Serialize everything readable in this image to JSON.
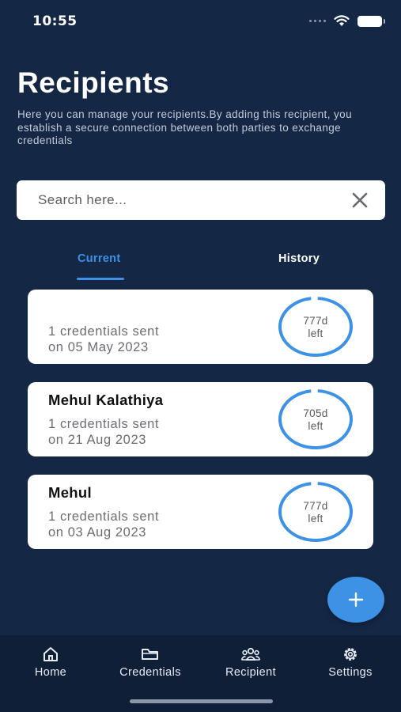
{
  "status_bar": {
    "time": "10:55",
    "icons": [
      "signal-dots-icon",
      "wifi-icon",
      "battery-icon"
    ]
  },
  "header": {
    "title": "Recipients",
    "description": "Here you can manage your recipients.By adding this recipient, you establish a secure connection between both parties to exchange credentials"
  },
  "search": {
    "placeholder": "Search here...",
    "value": "",
    "clear_icon": "close-icon"
  },
  "tabs": [
    {
      "label": "Current",
      "active": true
    },
    {
      "label": "History",
      "active": false
    }
  ],
  "recipients": [
    {
      "name": "",
      "sent": "1 credentials sent",
      "date": "on 05 May 2023",
      "days": "777d",
      "suffix": "left",
      "progress": 0.97
    },
    {
      "name": "Mehul Kalathiya",
      "sent": "1 credentials sent",
      "date": "on 21 Aug 2023",
      "days": "705d",
      "suffix": "left",
      "progress": 0.97
    },
    {
      "name": "Mehul",
      "sent": "1 credentials sent",
      "date": "on 03 Aug 2023",
      "days": "777d",
      "suffix": "left",
      "progress": 0.97
    }
  ],
  "fab": {
    "icon": "plus-icon"
  },
  "bottom_nav": [
    {
      "label": "Home",
      "icon": "home-icon"
    },
    {
      "label": "Credentials",
      "icon": "folder-icon"
    },
    {
      "label": "Recipient",
      "icon": "group-icon"
    },
    {
      "label": "Settings",
      "icon": "gear-icon"
    }
  ],
  "colors": {
    "background": "#142845",
    "accent": "#3d92e6",
    "card": "#ffffff",
    "nav": "#0f1f38"
  }
}
